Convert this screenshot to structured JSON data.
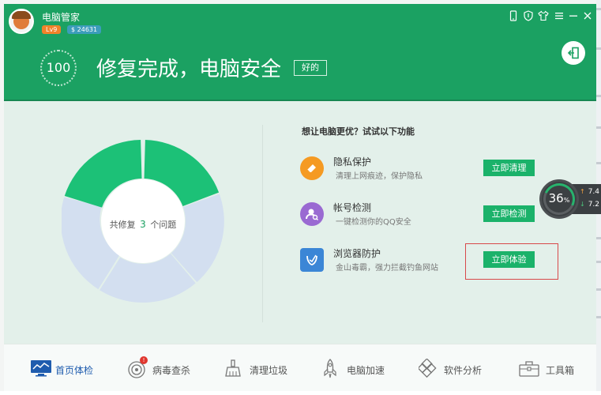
{
  "header": {
    "app_title": "电脑管家",
    "level": "Lv9",
    "coins": "$ 24631",
    "score": "100",
    "status_title": "修复完成，电脑安全",
    "status_tag": "好的",
    "title_buttons": [
      "phone-icon",
      "shield-icon",
      "shirt-icon",
      "menu-icon",
      "minimize-icon",
      "close-icon"
    ]
  },
  "main": {
    "fixed_prefix": "共修复",
    "fixed_count": "3",
    "fixed_suffix": "个问题",
    "suggest_title": "想让电脑更优？试试以下功能",
    "features": [
      {
        "name": "隐私保护",
        "desc": "清理上网痕迹，保护隐私",
        "button": "立即清理",
        "icon": "eraser-icon",
        "color": "#f59a22"
      },
      {
        "name": "帐号检测",
        "desc": "一键检测你的QQ安全",
        "button": "立即检测",
        "icon": "account-search-icon",
        "color": "#9a6ad2"
      },
      {
        "name": "浏览器防护",
        "desc": "金山毒霸，强力拦截钓鱼网站",
        "button": "立即体验",
        "icon": "browser-shield-icon",
        "color": "#3b86d6"
      }
    ]
  },
  "speed_ball": {
    "value": "36",
    "unit": "%",
    "up": "7.4",
    "down": "7.2"
  },
  "nav": [
    {
      "label": "首页体检",
      "icon": "monitor-icon",
      "active": true
    },
    {
      "label": "病毒查杀",
      "icon": "virus-scan-icon",
      "badge": "!"
    },
    {
      "label": "清理垃圾",
      "icon": "broom-icon"
    },
    {
      "label": "电脑加速",
      "icon": "rocket-icon"
    },
    {
      "label": "软件分析",
      "icon": "software-icon"
    },
    {
      "label": "工具箱",
      "icon": "toolbox-icon"
    }
  ],
  "colors": {
    "brand": "#1ba162",
    "button": "#1bb26a",
    "active_nav": "#1f5cae",
    "highlight": "#d8494a"
  }
}
